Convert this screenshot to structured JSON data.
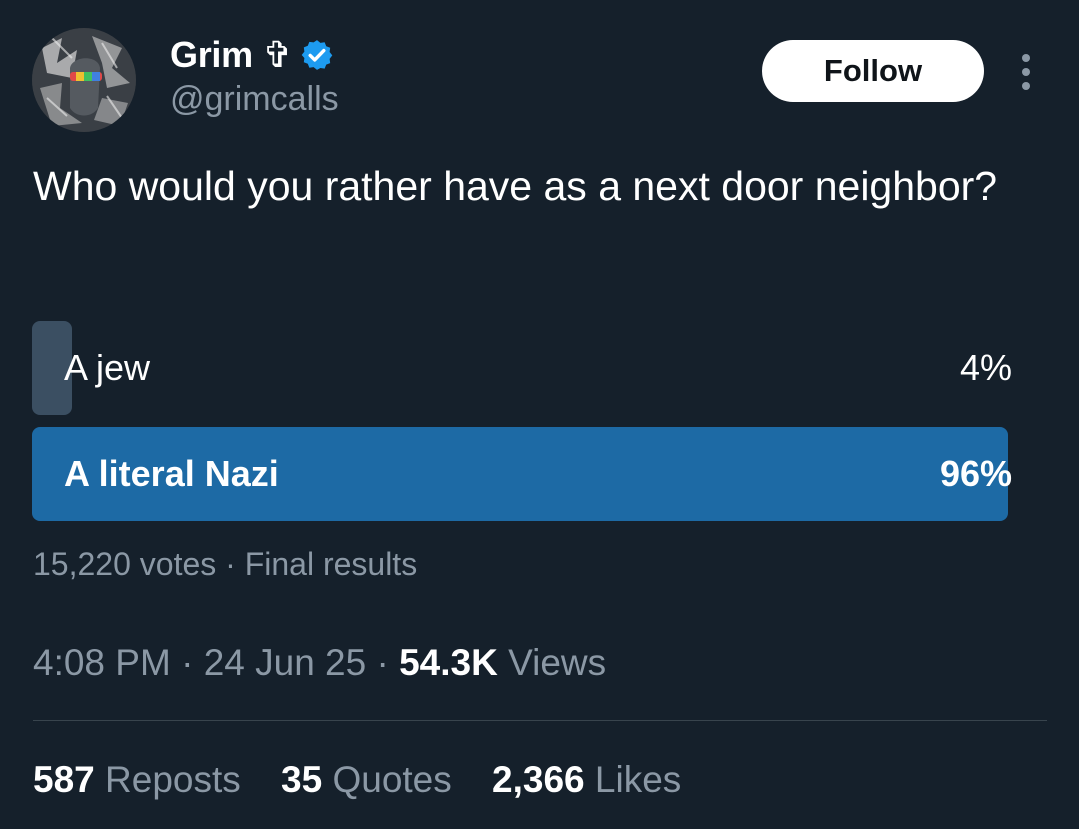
{
  "author": {
    "display_name": "Grim ✞",
    "handle": "@grimcalls",
    "verified": true,
    "verified_color": "#1d9bf0",
    "avatar_icon": "avatar-image"
  },
  "actions": {
    "follow_label": "Follow",
    "more_icon": "more-vertical-icon"
  },
  "tweet": {
    "text": "Who would you rather have as a next door neighbor?"
  },
  "poll": {
    "options": [
      {
        "label": "A jew",
        "percent_text": "4%",
        "percent": 4,
        "winner": false
      },
      {
        "label": "A literal Nazi",
        "percent_text": "96%",
        "percent": 96,
        "winner": true
      }
    ],
    "votes": "15,220 votes",
    "separator": "·",
    "status": "Final results",
    "winner_color": "#1d6aa5",
    "loser_color": "#3b4f62"
  },
  "meta": {
    "time": "4:08 PM",
    "date": "24 Jun 25",
    "views_count": "54.3K",
    "views_label": "Views",
    "separator": "·"
  },
  "stats": {
    "reposts_count": "587",
    "reposts_label": "Reposts",
    "quotes_count": "35",
    "quotes_label": "Quotes",
    "likes_count": "2,366",
    "likes_label": "Likes"
  },
  "colors": {
    "background": "#15202b",
    "secondary_text": "#8b98a5",
    "divider": "#38444d"
  }
}
